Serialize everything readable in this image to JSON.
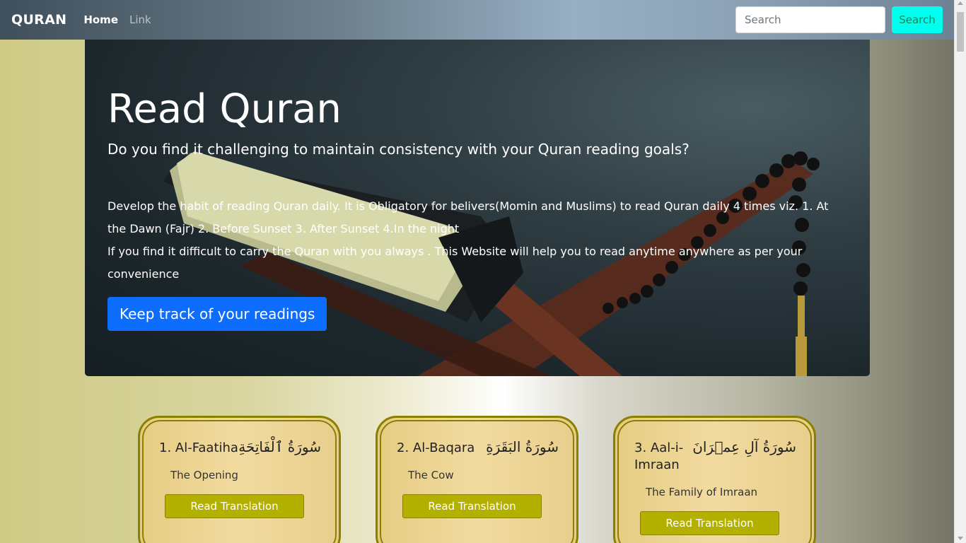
{
  "navbar": {
    "brand": "QURAN",
    "links": [
      {
        "label": "Home"
      },
      {
        "label": "Link"
      }
    ],
    "search": {
      "placeholder": "Search",
      "value": "",
      "button_label": "Search"
    }
  },
  "hero": {
    "title": "Read Quran",
    "subtitle": "Do you find it challenging to maintain consistency with your Quran reading goals?",
    "paragraph1": "Develop the habit of reading Quran daily. It is Obligatory for belivers(Momin and Muslims) to read Quran daily 4 times viz. 1. At the Dawn (Fajr) 2. Before Sunset 3. After Sunset 4.In the night",
    "paragraph2": "If you find it difficult to carry the Quran with you always . This Website will help you to read anytime anywhere as per your convenience",
    "button_label": "Keep track of your readings"
  },
  "surahs": [
    {
      "name": "1. Al-Faatiha",
      "arabic": "سُورَةُ ٱلْفَاتِحَةِ",
      "english": "The Opening",
      "button_label": "Read Translation"
    },
    {
      "name": "2. Al-Baqara",
      "arabic": "سُورَةُ البَقَرَةِ",
      "english": "The Cow",
      "button_label": "Read Translation"
    },
    {
      "name": "3. Aal-i-Imraan",
      "arabic": "سُورَةُ آلِ عِمۡرَانَ",
      "english": "The Family of Imraan",
      "button_label": "Read Translation"
    }
  ],
  "colors": {
    "primary_button": "#0d6efd",
    "search_button": "#00ffef",
    "card_button": "#b3b000",
    "card_border": "#8a8000"
  }
}
